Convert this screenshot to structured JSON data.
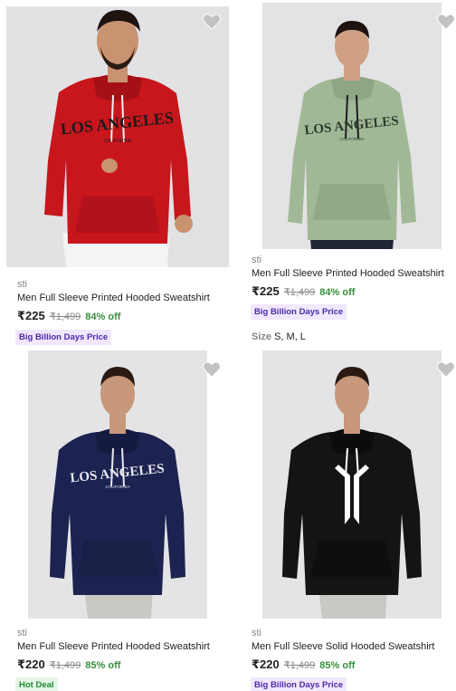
{
  "products": [
    {
      "brand": "sti",
      "title": "Men Full Sleeve Printed Hooded Sweatshirt",
      "price": "₹225",
      "mrp": "₹1,499",
      "discount": "84% off",
      "badge": "Big Billion Days Price",
      "print_text": "LOS ANGELES",
      "print_subtext": "CALIFORNIA",
      "colors": {
        "hoodie": "#c8161d",
        "bg": "#e2e2e4",
        "pants": "#f4f4f4",
        "print": "#1b1b1b"
      },
      "icon": "heart-icon"
    },
    {
      "brand": "sti",
      "title": "Men Full Sleeve Printed Hooded Sweatshirt",
      "price": "₹225",
      "mrp": "₹1,499",
      "discount": "84% off",
      "badge": "Big Billion Days Price",
      "size_label": "Size",
      "sizes": "S, M, L",
      "print_text": "LOS ANGELES",
      "print_subtext": "CALIFORNIA",
      "colors": {
        "hoodie": "#a1b896",
        "bg": "#e3e3e5",
        "pants": "#1d2433",
        "print": "#2d3a2d"
      },
      "icon": "heart-icon"
    },
    {
      "brand": "sti",
      "title": "Men Full Sleeve Printed Hooded Sweatshirt",
      "price": "₹220",
      "mrp": "₹1,499",
      "discount": "85% off",
      "badge": "Hot Deal",
      "print_text": "LOS ANGELES",
      "print_subtext": "CALIFORNIA",
      "colors": {
        "hoodie": "#1c2350",
        "bg": "#e4e4e6",
        "pants": "#c6c9c4",
        "print": "#e8e8f0"
      },
      "icon": "heart-icon"
    },
    {
      "brand": "sti",
      "title": "Men Full Sleeve Solid Hooded Sweatshirt",
      "price": "₹220",
      "mrp": "₹1,499",
      "discount": "85% off",
      "badge": "Big Billion Days Price",
      "colors": {
        "hoodie": "#141414",
        "bg": "#e4e4e6",
        "pants": "#c6c9c4",
        "print": "#ffffff"
      },
      "icon": "heart-icon"
    }
  ]
}
